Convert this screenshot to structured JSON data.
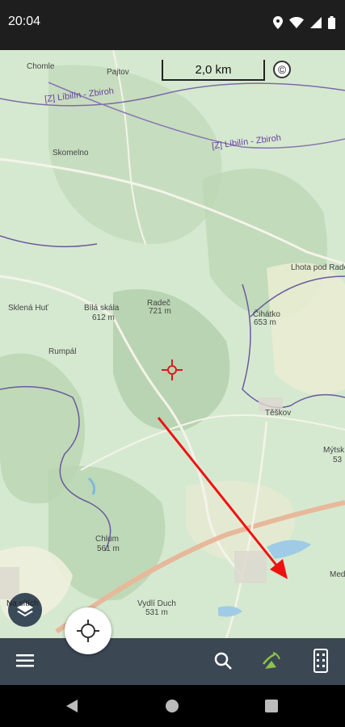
{
  "status_bar": {
    "time": "20:04",
    "icons": [
      "location-icon",
      "wifi-icon",
      "signal-icon",
      "battery-icon"
    ]
  },
  "map": {
    "scale_label": "2,0 km",
    "copyright_symbol": "©",
    "place_labels": [
      {
        "text": "Chomle"
      },
      {
        "text": "Pajtov"
      },
      {
        "text": "Skomelno"
      },
      {
        "text": "Sklená Huť"
      },
      {
        "text": "Bílá skála"
      },
      {
        "text": "612 m"
      },
      {
        "text": "Radeč"
      },
      {
        "text": "721 m"
      },
      {
        "text": "Čihátko"
      },
      {
        "text": "653 m"
      },
      {
        "text": "Lhota pod Rade"
      },
      {
        "text": "Rumpál"
      },
      {
        "text": "Těškov"
      },
      {
        "text": "Mýtsk"
      },
      {
        "text": "53"
      },
      {
        "text": "Chlum"
      },
      {
        "text": "561 m"
      },
      {
        "text": "Vydlí Duch"
      },
      {
        "text": "531 m"
      },
      {
        "text": "Med"
      }
    ],
    "trail_labels": [
      "[Z] Líbilín - Zbiroh",
      "[Z] Líbilín - Zbiroh"
    ],
    "layers_label": "Na sítích"
  },
  "bottom_bar": {
    "icons": [
      "menu-icon",
      "search-icon",
      "gps-signal-icon",
      "plugin-icon"
    ]
  },
  "colors": {
    "map_bg": "#d4e8cf",
    "bottom_bar": "#3b4753",
    "annotation_red": "#d61c1c"
  }
}
